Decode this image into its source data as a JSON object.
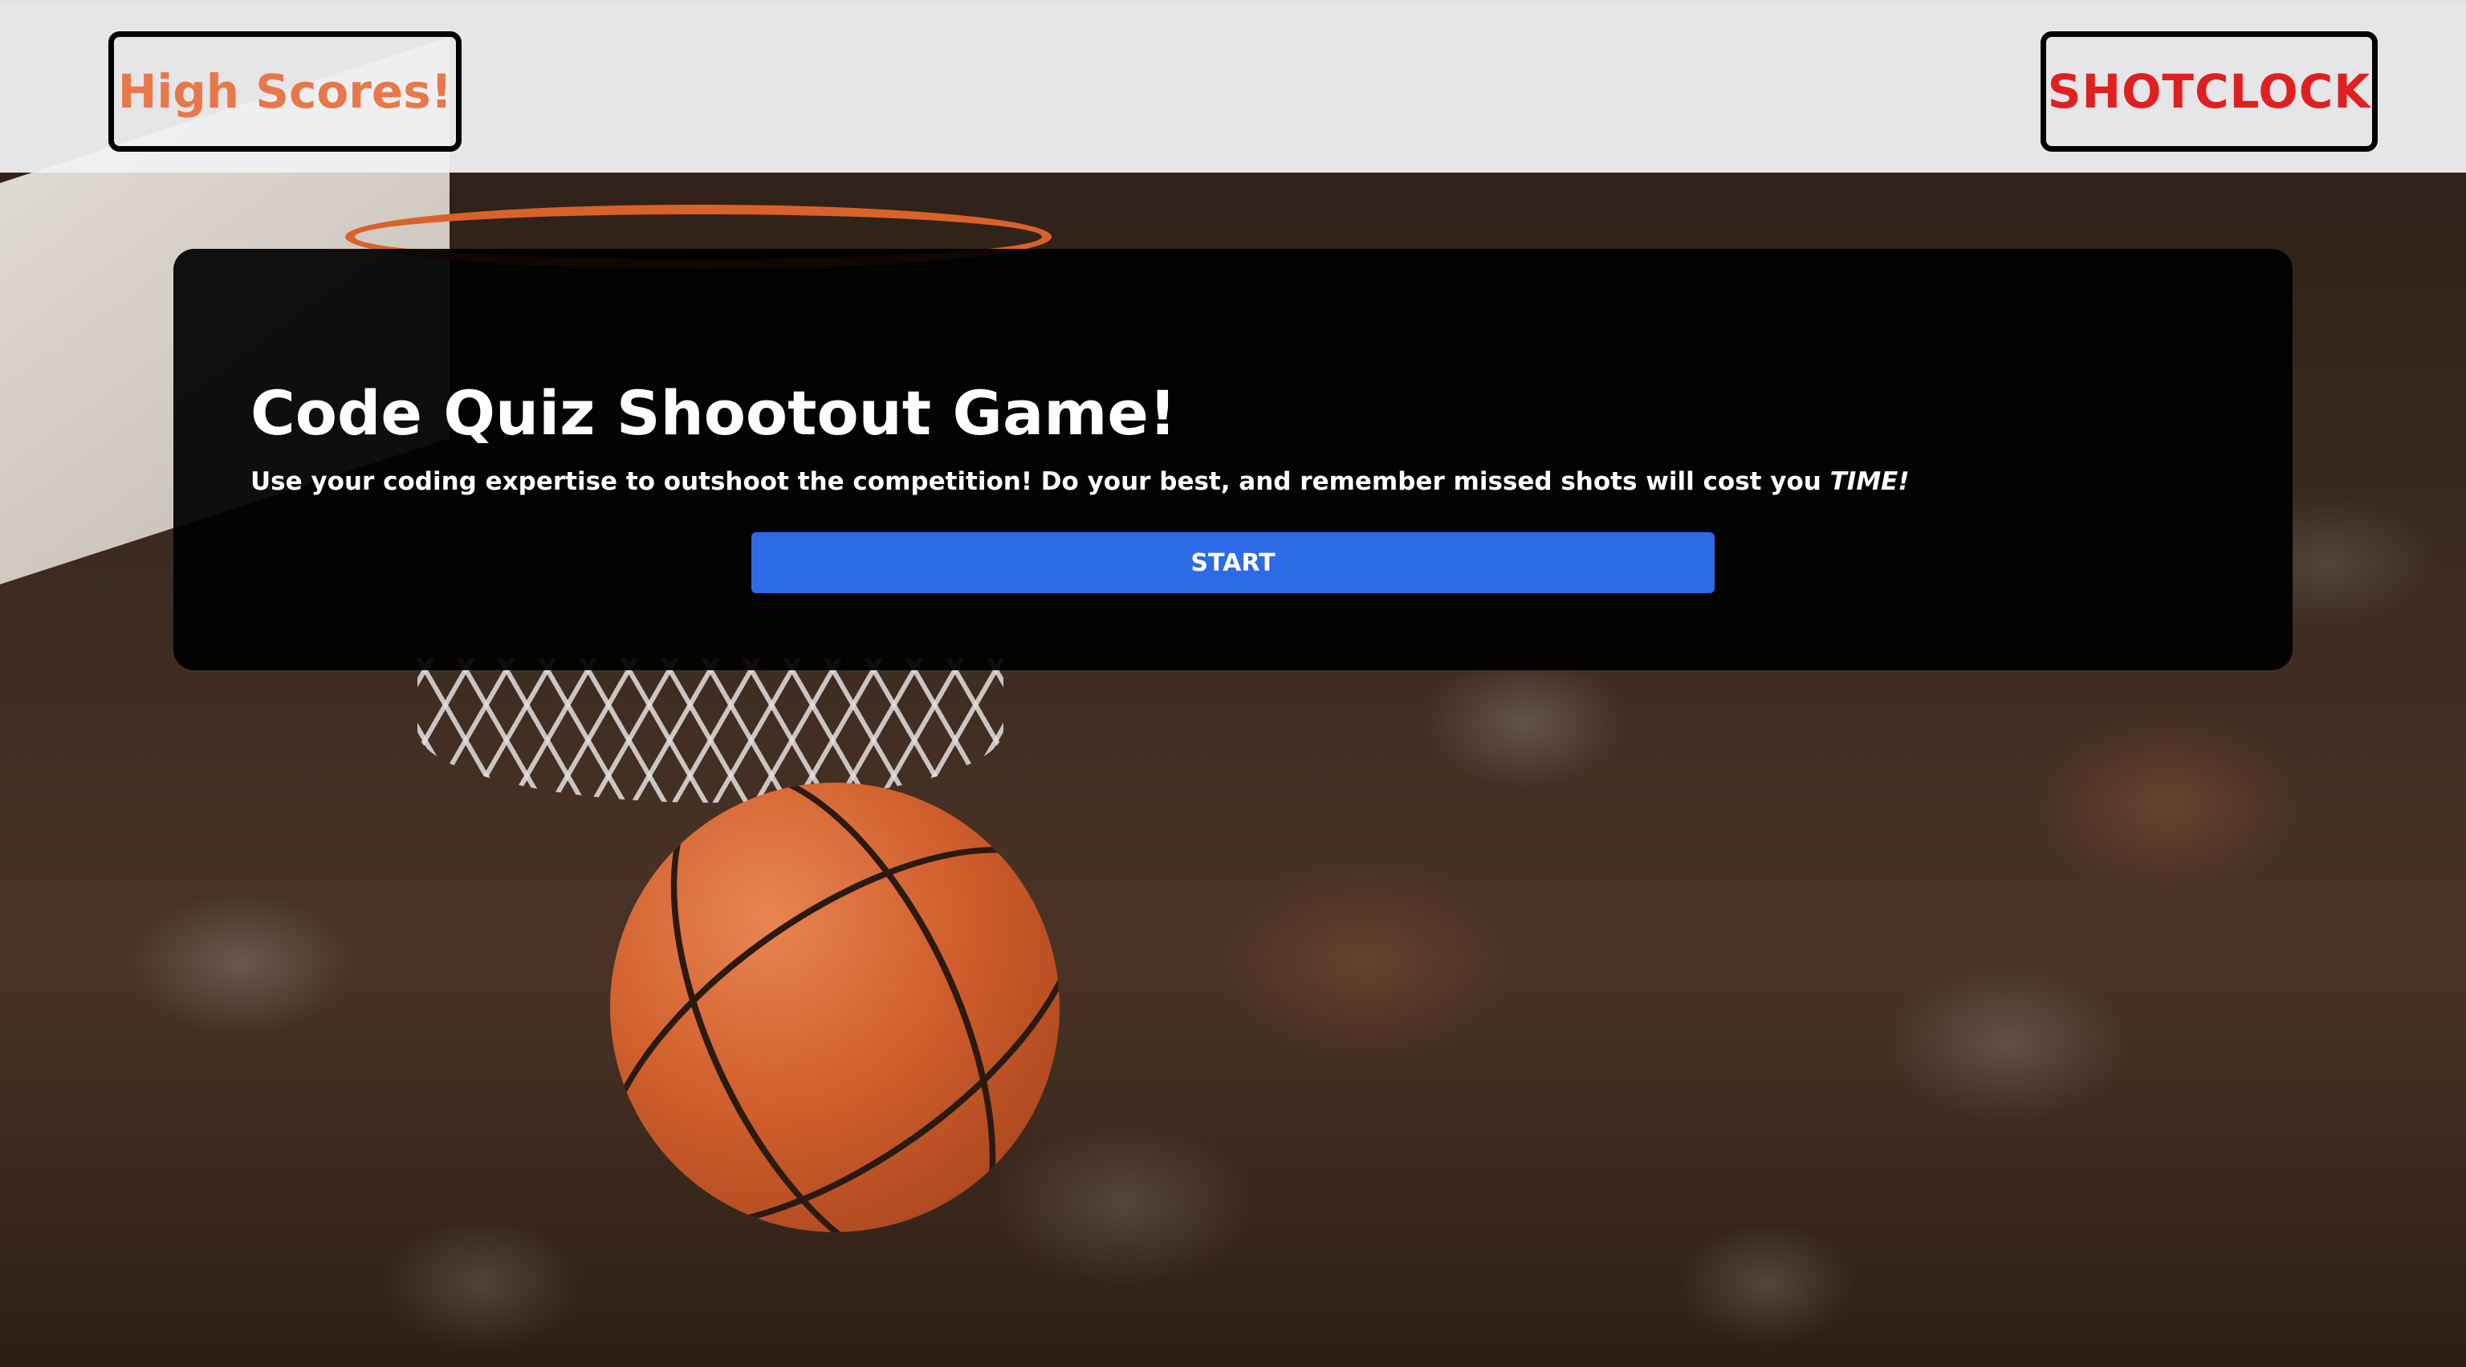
{
  "header": {
    "high_scores_label": "High Scores!",
    "shotclock_label": "SHOTCLOCK"
  },
  "main": {
    "title": "Code Quiz Shootout Game!",
    "subtitle_text": "Use your coding expertise to outshoot the competition! Do your best, and remember missed shots will cost you ",
    "subtitle_emphasis": "TIME!",
    "start_label": "START"
  },
  "colors": {
    "high_scores": "#e8784a",
    "shotclock": "#e02020",
    "start_button": "#2d6ae6",
    "card_background": "#000000",
    "header_background": "#f0f0f2"
  },
  "background": {
    "image_subject": "basketball-through-hoop-with-crowd"
  }
}
